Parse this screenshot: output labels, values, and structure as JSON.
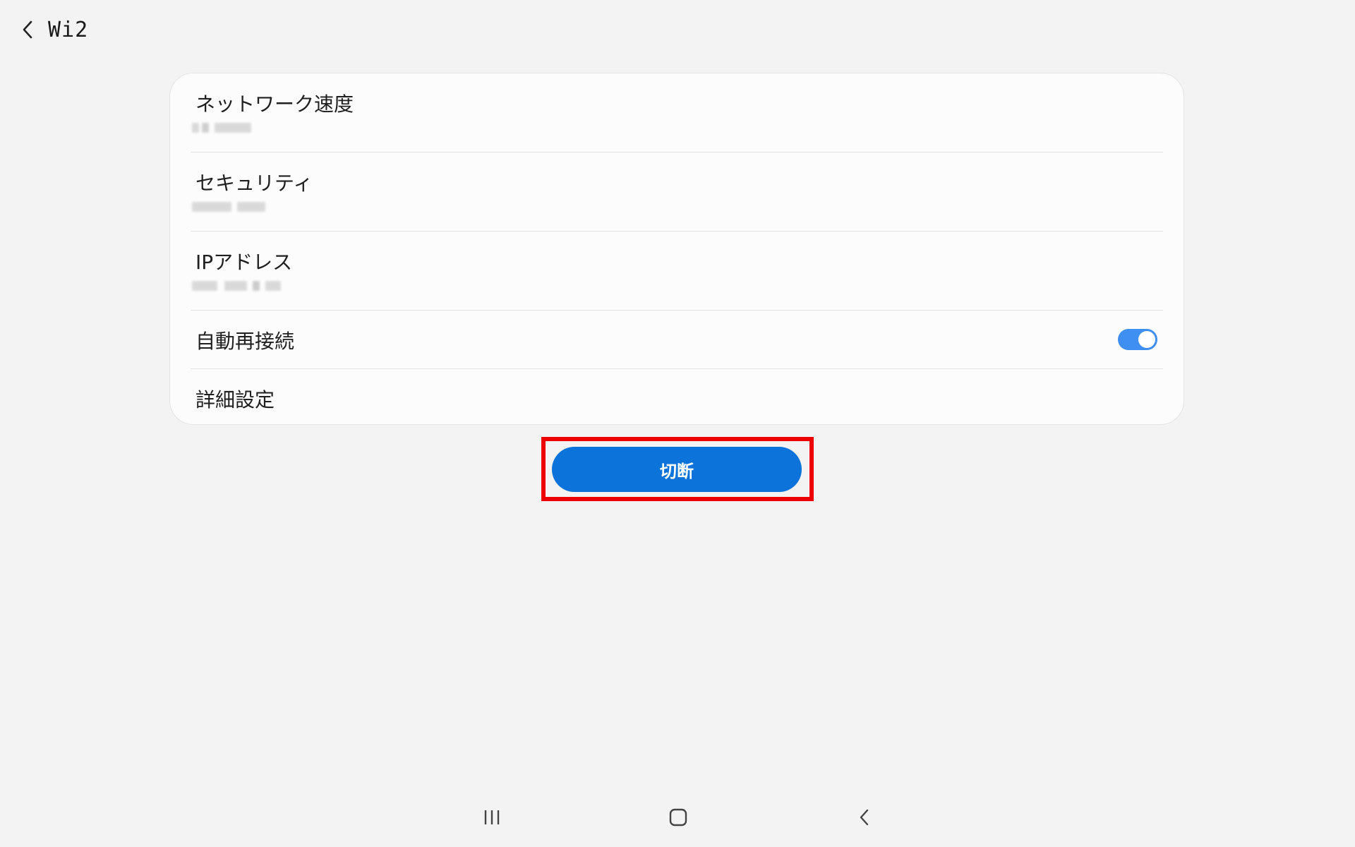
{
  "header": {
    "title": "Wi2",
    "back_icon": "chevron-left-icon"
  },
  "details": {
    "rows": [
      {
        "label": "ネットワーク速度",
        "value_redacted": true
      },
      {
        "label": "セキュリティ",
        "value_redacted": true
      },
      {
        "label": "IPアドレス",
        "value_redacted": true
      },
      {
        "label": "自動再接続",
        "toggle_on": true
      },
      {
        "label": "詳細設定"
      }
    ]
  },
  "disconnect_button": {
    "label": "切断"
  },
  "colors": {
    "background": "#f3f3f3",
    "card": "#fcfcfc",
    "accent": "#0b73d9",
    "toggle": "#3f8ef2",
    "highlight": "#ee0000"
  },
  "navigation_bar": {
    "icons": [
      "recent-apps-icon",
      "home-icon",
      "back-icon"
    ]
  }
}
